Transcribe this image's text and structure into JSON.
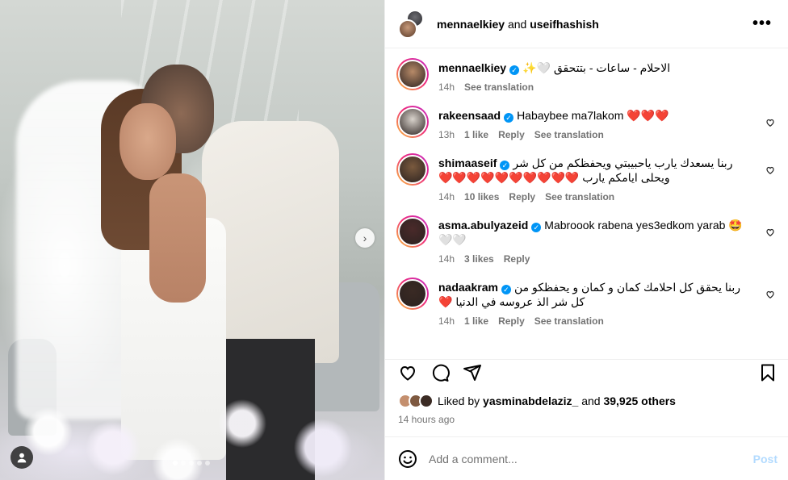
{
  "post": {
    "header": {
      "user1": "mennaelkiey",
      "conjunction": "and",
      "user2": "useifhashish",
      "more_label": "•••"
    },
    "carousel": {
      "next_label": "›",
      "total_slides": 5,
      "current_slide": 1
    },
    "comments": [
      {
        "user": "mennaelkiey",
        "text": "الاحلام - ساعات - بتتحقق 🤍✨",
        "time": "14h",
        "likes": "",
        "reply": "",
        "translation": "See translation",
        "avatar_color": "#b78a68",
        "is_caption": true
      },
      {
        "user": "rakeensaad",
        "text": "Habaybee ma7lakom ❤️❤️❤️",
        "time": "13h",
        "likes": "1 like",
        "reply": "Reply",
        "translation": "See translation",
        "avatar_color": "#d9d3cc",
        "is_caption": false
      },
      {
        "user": "shimaaseif",
        "text": "ربنا يسعدك يارب ياحبيبتي ويحفظكم من كل شر ويحلى ايامكم يارب ❤️❤️❤️❤️❤️❤️❤️❤️❤️❤️",
        "time": "14h",
        "likes": "10 likes",
        "reply": "Reply",
        "translation": "See translation",
        "avatar_color": "#7a5a3e",
        "is_caption": false
      },
      {
        "user": "asma.abulyazeid",
        "text": "Mabroook rabena yes3edkom yarab 🤩🤍🤍",
        "time": "14h",
        "likes": "3 likes",
        "reply": "Reply",
        "translation": "",
        "avatar_color": "#4a2a2a",
        "is_caption": false
      },
      {
        "user": "nadaakram",
        "text": "ربنا يحقق كل احلامك كمان و كمان و يحفظكو من كل شر الذ عروسه في الدنيا ❤️",
        "time": "14h",
        "likes": "1 like",
        "reply": "Reply",
        "translation": "See translation",
        "avatar_color": "#3a2a24",
        "is_caption": false
      }
    ],
    "likes": {
      "prefix": "Liked by",
      "user": "yasminabdelaziz_",
      "and": "and",
      "count": "39,925 others"
    },
    "time_ago": "14 hours ago",
    "add_comment": {
      "placeholder": "Add a comment...",
      "post_label": "Post",
      "emoji_icon": "smiley-icon"
    },
    "colors": {
      "verified": "#0095f6",
      "meta_gray": "#737373",
      "post_disabled": "#b3dbff",
      "heart_red": "#e0241b"
    }
  }
}
